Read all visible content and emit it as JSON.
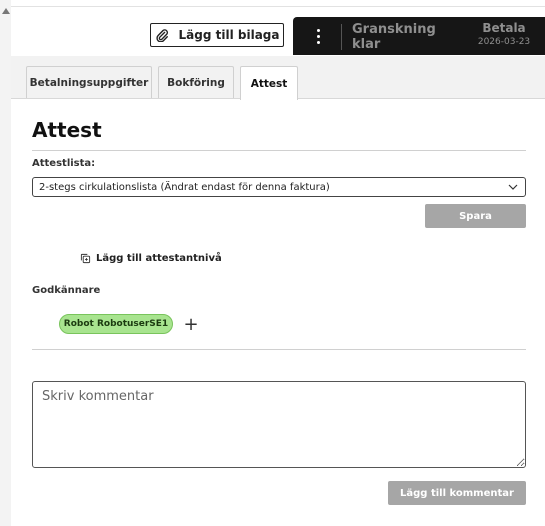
{
  "header": {
    "attach_label": "Lägg till bilaga",
    "review_label": "Granskning klar",
    "pay_label": "Betala",
    "pay_date": "2026-03-23"
  },
  "tabs": [
    {
      "label": "Betalningsuppgifter",
      "active": false
    },
    {
      "label": "Bokföring",
      "active": false
    },
    {
      "label": "Attest",
      "active": true
    }
  ],
  "section": {
    "title": "Attest",
    "list_label": "Attestlista:",
    "list_value": "2-stegs cirkulationslista (Ändrat endast för denna faktura)",
    "save_label": "Spara",
    "add_level_label": "Lägg till attestantnivå",
    "approvers_label": "Godkännare",
    "approver_name": "Robot RobotuserSE1"
  },
  "comment": {
    "placeholder": "Skriv kommentar",
    "value": "",
    "submit_label": "Lägg till kommentar"
  },
  "icons": {
    "attach": "paperclip-icon",
    "more": "more-vertical-icon",
    "dropdown": "chevron-down-icon",
    "add_level": "copy-add-icon",
    "add_approver": "plus-icon"
  },
  "colors": {
    "dark_bar": "#161616",
    "disabled_button": "#a6a6a6",
    "chip_green": "#a8e48f"
  }
}
